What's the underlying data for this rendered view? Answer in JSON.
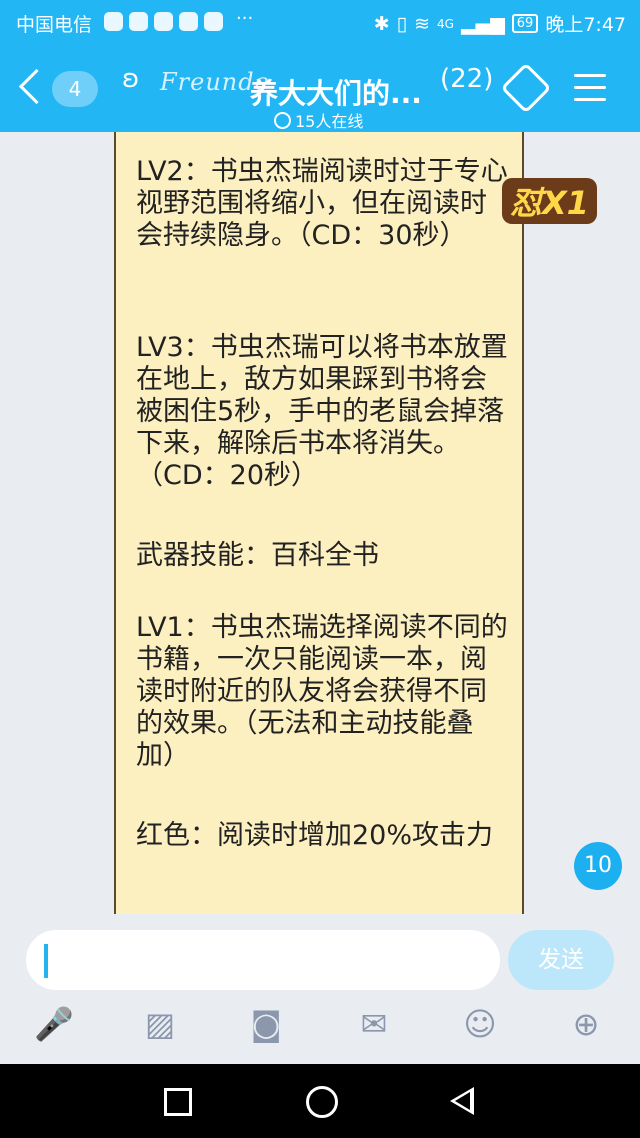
{
  "status_bar": {
    "carrier": "中国电信",
    "extra": "···",
    "network": "4G",
    "battery": "69",
    "time": "晚上7:47"
  },
  "header": {
    "unread_count": "4",
    "brand": "Freunde",
    "title": "养大大们的...",
    "member_count": "(22)",
    "online": "15人在线"
  },
  "message": {
    "paragraphs": [
      "LV2：书虫杰瑞阅读时过于专心视野范围将缩小，但在阅读时会持续隐身。（CD：30秒）",
      "LV3：书虫杰瑞可以将书本放置在地上，敌方如果踩到书将会被困住5秒，手中的老鼠会掉落下来，解除后书本将消失。（CD：20秒）",
      "武器技能：百科全书",
      "LV1：书虫杰瑞选择阅读不同的书籍，一次只能阅读一本，阅读时附近的队友将会获得不同的效果。（无法和主动技能叠加）",
      "红色：阅读时增加20%攻击力"
    ]
  },
  "sticker": "怼X1",
  "floating_badge": "10",
  "input": {
    "send_label": "发送"
  },
  "toolbar": [
    "mic-icon",
    "image-icon",
    "camera-icon",
    "red-packet-icon",
    "emoji-icon",
    "plus-icon"
  ],
  "colors": {
    "accent": "#22b6f5",
    "bubble": "#fcefc0"
  }
}
